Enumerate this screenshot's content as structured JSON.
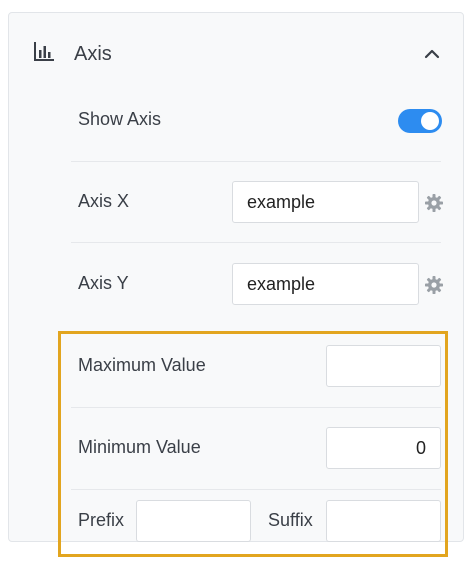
{
  "section": {
    "title": "Axis",
    "icon": "bar-chart-icon",
    "collapse_icon": "chevron-up-icon"
  },
  "show_axis": {
    "label": "Show Axis",
    "enabled": true
  },
  "axis_x": {
    "label": "Axis X",
    "value": "example",
    "settings_icon": "gear-icon"
  },
  "axis_y": {
    "label": "Axis Y",
    "value": "example",
    "settings_icon": "gear-icon"
  },
  "maximum_value": {
    "label": "Maximum Value",
    "value": ""
  },
  "minimum_value": {
    "label": "Minimum Value",
    "value": "0"
  },
  "prefix": {
    "label": "Prefix",
    "value": ""
  },
  "suffix": {
    "label": "Suffix",
    "value": ""
  },
  "colors": {
    "toggle_on": "#2d8cf0",
    "highlight_border": "#e2a51f",
    "panel_background": "#f8f9fa"
  }
}
